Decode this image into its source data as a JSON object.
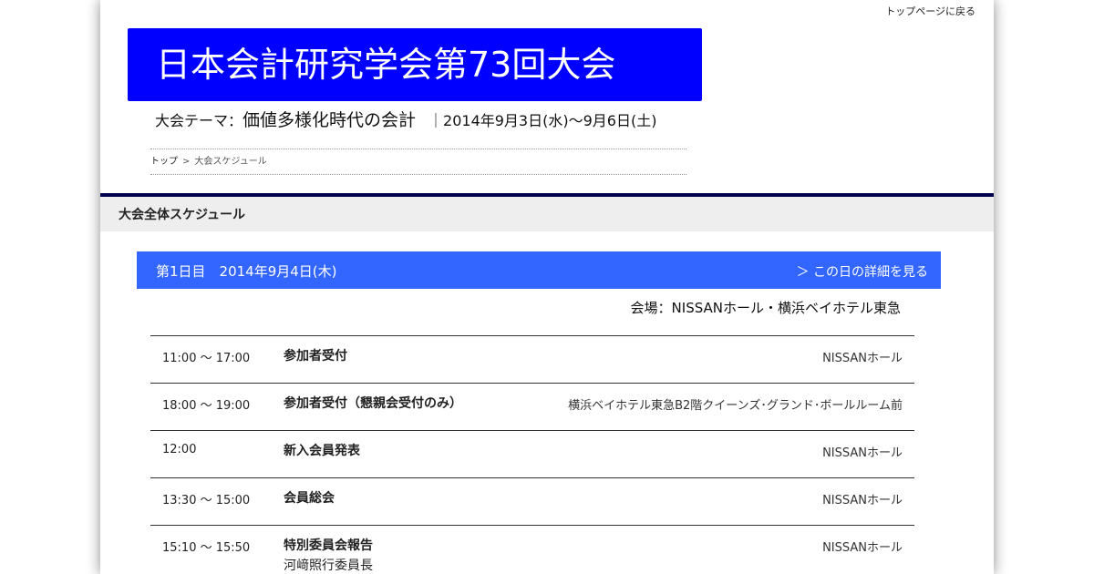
{
  "header": {
    "top_link": "トップページに戻る",
    "title": "日本会計研究学会第73回大会",
    "theme_prefix": "大会テーマ：",
    "theme_title": "価値多様化時代の会計",
    "dates": "｜2014年9月3日(水)～9月6日(土)"
  },
  "breadcrumb": {
    "home": "トップ",
    "separator": ">",
    "current": "大会スケジュール"
  },
  "section": {
    "title": "大会全体スケジュール"
  },
  "day": {
    "label": "第1日目　2014年9月4日(木)",
    "detail_link": "＞ この日の詳細を見る",
    "venue": "会場：NISSANホール・横浜ベイホテル東急"
  },
  "schedule": [
    {
      "time": "11:00 ～ 17:00",
      "event": "参加者受付",
      "sub": "",
      "place": "NISSANホール"
    },
    {
      "time": "18:00 ～ 19:00",
      "event": "参加者受付（懇親会受付のみ）",
      "sub": "",
      "place": "横浜ベイホテル東急B2階クイーンズ･グランド･ボールルーム前"
    },
    {
      "time": "12:00",
      "event": "新入会員発表",
      "sub": "",
      "place": "NISSANホール"
    },
    {
      "time": "13:30 ～ 15:00",
      "event": "会員総会",
      "sub": "",
      "place": "NISSANホール"
    },
    {
      "time": "15:10 ～ 15:50",
      "event": "特別委員会報告",
      "sub": "河﨑照行委員長",
      "place": "NISSANホール"
    }
  ],
  "colors": {
    "title_banner": "#0000ff",
    "day_header": "#3366ff",
    "section_border": "#00004a",
    "section_bg": "#eeeeee"
  }
}
